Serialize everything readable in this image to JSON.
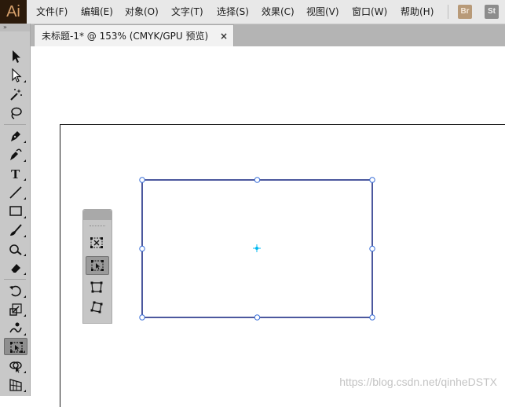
{
  "app": {
    "logo": "Ai",
    "logo_color": "#d6a06b",
    "logo_bg": "#2b1a0b"
  },
  "menu": [
    {
      "label": "文件(F)"
    },
    {
      "label": "编辑(E)"
    },
    {
      "label": "对象(O)"
    },
    {
      "label": "文字(T)"
    },
    {
      "label": "选择(S)"
    },
    {
      "label": "效果(C)"
    },
    {
      "label": "视图(V)"
    },
    {
      "label": "窗口(W)"
    },
    {
      "label": "帮助(H)"
    }
  ],
  "bridge_buttons": [
    {
      "label": "Br"
    },
    {
      "label": "St"
    }
  ],
  "toolbar": {
    "grip": "»",
    "tools": [
      {
        "icon": "selection-arrow-icon"
      },
      {
        "icon": "direct-selection-arrow-icon"
      },
      {
        "icon": "magic-wand-icon"
      },
      {
        "icon": "lasso-icon"
      },
      {
        "icon": "pen-icon"
      },
      {
        "icon": "curvature-pen-icon"
      },
      {
        "icon": "type-icon",
        "glyph": "T"
      },
      {
        "icon": "line-segment-icon"
      },
      {
        "icon": "rectangle-icon"
      },
      {
        "icon": "paintbrush-icon"
      },
      {
        "icon": "blob-brush-icon"
      },
      {
        "icon": "eraser-icon"
      },
      {
        "icon": "rotate-icon"
      },
      {
        "icon": "scale-icon"
      },
      {
        "icon": "warp-icon"
      },
      {
        "icon": "free-transform-icon",
        "active": true
      },
      {
        "icon": "shape-builder-icon"
      },
      {
        "icon": "perspective-grid-icon"
      }
    ]
  },
  "document_tab": {
    "label": "未标题-1* @ 153% (CMYK/GPU 预览)",
    "close": "×"
  },
  "float_panel": {
    "tools": [
      {
        "icon": "constrain-icon"
      },
      {
        "icon": "free-transform-widget-icon",
        "active": true
      },
      {
        "icon": "perspective-distort-icon"
      },
      {
        "icon": "free-distort-icon"
      }
    ]
  },
  "selection": {
    "stroke_color": "#1f2f86",
    "handle_color": "#3a6fd8",
    "center_color": "#00b8f0"
  },
  "watermark": "https://blog.csdn.net/qinheDSTX"
}
